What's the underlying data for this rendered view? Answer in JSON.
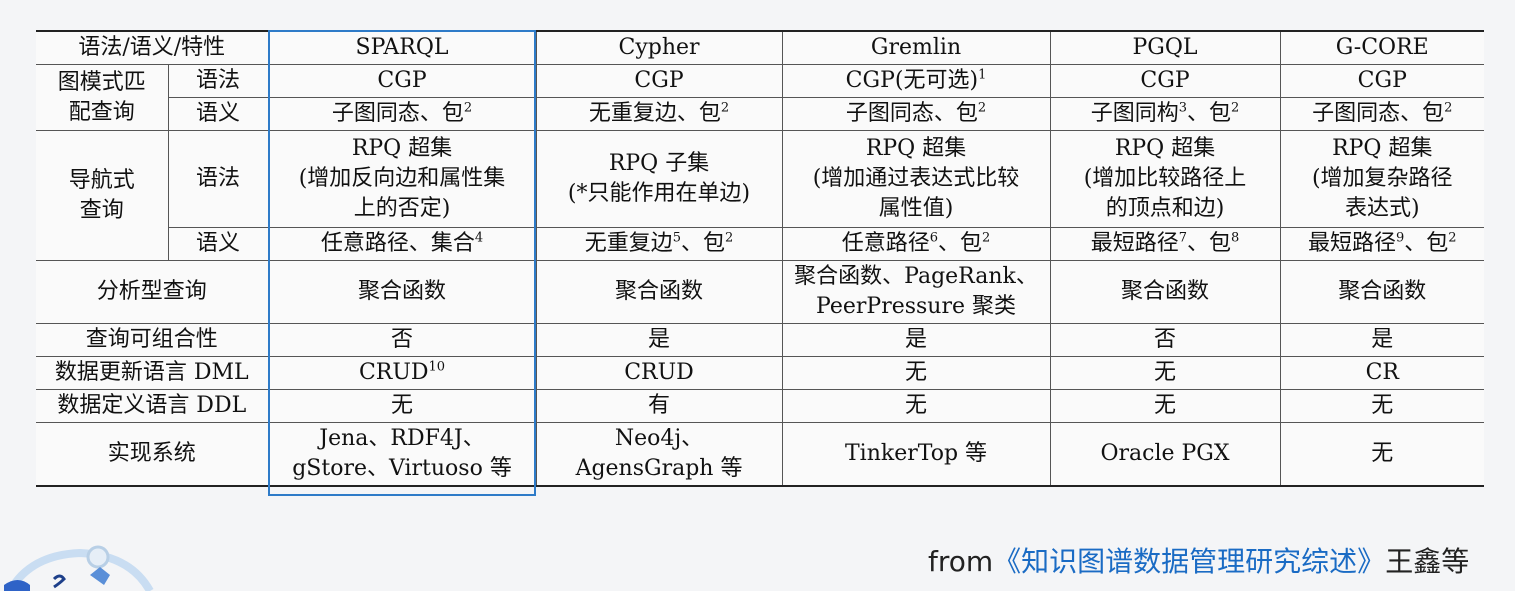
{
  "table": {
    "header": [
      "语法/语义/特性",
      "SPARQL",
      "Cypher",
      "Gremlin",
      "PGQL",
      "G-CORE"
    ],
    "pattern": {
      "label": "图模式匹\n配查询",
      "syntax_label": "语法",
      "syntax": [
        "CGP",
        "CGP",
        "CGP(无可选)",
        "CGP",
        "CGP"
      ],
      "syntax_sup": [
        "",
        "",
        "1",
        "",
        ""
      ],
      "semantics_label": "语义",
      "semantics": [
        "子图同态、包",
        "无重复边、包",
        "子图同态、包",
        "子图同构",
        "子图同态、包"
      ],
      "semantics_sup": [
        "2",
        "2",
        "2",
        "3",
        "2"
      ],
      "semantics_tail": [
        "",
        "",
        "",
        "、包",
        ""
      ],
      "semantics_tail_sup": [
        "",
        "",
        "",
        "2",
        ""
      ]
    },
    "nav": {
      "label": "导航式\n查询",
      "syntax_label": "语法",
      "syntax": [
        "RPQ 超集\n(增加反向边和属性集\n上的否定)",
        "RPQ 子集\n(*只能作用在单边)",
        "RPQ 超集\n(增加通过表达式比较\n属性值)",
        "RPQ 超集\n(增加比较路径上\n的顶点和边)",
        "RPQ 超集\n(增加复杂路径\n表达式)"
      ],
      "semantics_label": "语义",
      "semantics": [
        "任意路径、集合",
        "无重复边",
        "任意路径",
        "最短路径",
        "最短路径"
      ],
      "semantics_sup": [
        "4",
        "5",
        "6",
        "7",
        "9"
      ],
      "semantics_tail": [
        "",
        "、包",
        "、包",
        "、包",
        "、包"
      ],
      "semantics_tail_sup": [
        "",
        "2",
        "2",
        "8",
        "2"
      ]
    },
    "analysis": {
      "label": "分析型查询",
      "values": [
        "聚合函数",
        "聚合函数",
        "聚合函数、PageRank、\nPeerPressure 聚类",
        "聚合函数",
        "聚合函数"
      ]
    },
    "composability": {
      "label": "查询可组合性",
      "values": [
        "否",
        "是",
        "是",
        "否",
        "是"
      ]
    },
    "dml": {
      "label": "数据更新语言 DML",
      "values": [
        "CRUD",
        "CRUD",
        "无",
        "无",
        "CR"
      ],
      "sup": [
        "10",
        "",
        "",
        "",
        ""
      ]
    },
    "ddl": {
      "label": "数据定义语言 DDL",
      "values": [
        "无",
        "有",
        "无",
        "无",
        "无"
      ]
    },
    "systems": {
      "label": "实现系统",
      "values": [
        "Jena、RDF4J、\ngStore、Virtuoso 等",
        "Neo4j、\nAgensGraph 等",
        "TinkerTop 等",
        "Oracle PGX",
        "无"
      ]
    }
  },
  "source": {
    "prefix": "from",
    "title": "《知识图谱数据管理研究综述》",
    "author": "王鑫等"
  },
  "colors": {
    "highlight": "#2e7bc8",
    "source_title": "#1a6bc4"
  }
}
